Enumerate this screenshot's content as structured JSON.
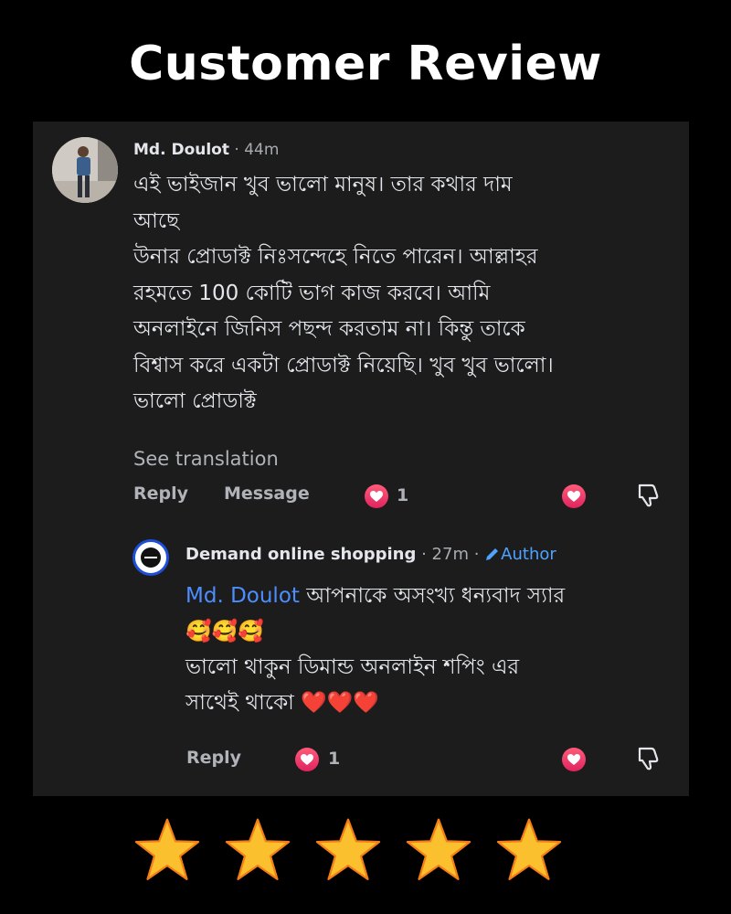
{
  "title": "Customer Review",
  "comment": {
    "author": "Md. Doulot",
    "time": "· 44m",
    "lines": [
      "এই ভাইজান খুব ভালো মানুষ। তার কথার দাম",
      "আছে",
      "উনার প্রোডাক্ট নিঃসন্দেহে নিতে পারেন। আল্লাহর",
      "রহমতে 100 কোটি ভাগ কাজ করবে। আমি",
      "অনলাইনে জিনিস পছন্দ করতাম না। কিন্তু তাকে",
      "বিশ্বাস করে একটা প্রোডাক্ট নিয়েছি। খুব খুব ভালো।",
      "ভালো প্রোডাক্ট"
    ],
    "see_translation": "See translation",
    "reply_label": "Reply",
    "message_label": "Message",
    "reaction_count": "1"
  },
  "reply": {
    "author": "Demand online shopping",
    "time": "· 27m ·",
    "badge": "Author",
    "mention": "Md. Doulot",
    "line1_rest": " আপনাকে অসংখ্য ধন্যবাদ স্যার",
    "line2": "🥰🥰🥰",
    "line3": "ভালো থাকুন ডিমান্ড অনলাইন শপিং এর",
    "line4": "সাথেই থাকো ❤️❤️❤️",
    "reply_label": "Reply",
    "reaction_count": "1"
  },
  "rating": {
    "stars": 5,
    "max": 5
  },
  "colors": {
    "background": "#000000",
    "card": "#1c1c1d",
    "heart": "#e0245e",
    "link_blue": "#4da3ff",
    "star": "#fbc02d"
  }
}
